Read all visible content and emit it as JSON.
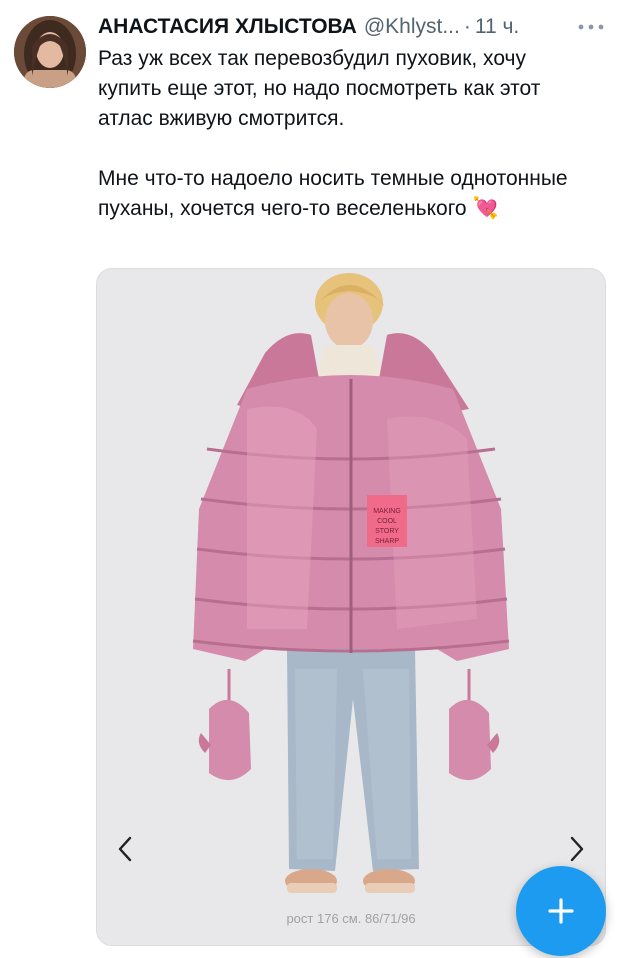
{
  "tweet": {
    "author_name": "АНАСТАСИЯ ХЛЫСТОВА",
    "author_handle": "@Khlyst...",
    "separator": "·",
    "time": "11 ч.",
    "more_icon": "more-horizontal-icon",
    "paragraph_1": "Раз уж всех так перевозбудил пуховик, хочу купить еще этот, но надо посмотреть как этот атлас вживую смотрится.",
    "paragraph_2": "Мне что-то надоело носить темные однотонные пуханы, хочется чего-то веселенького",
    "emoji": "💘"
  },
  "media": {
    "caption": "рост 176 см. 86/71/96",
    "patch_text": "MAKING COOL STORY SHARP",
    "prev_icon": "chevron-left-icon",
    "next_icon": "chevron-right-icon"
  },
  "compose": {
    "icon": "plus-icon"
  },
  "colors": {
    "accent": "#1d9bf0",
    "text": "#0f1419",
    "muted": "#536471",
    "jacket": "#d58bab"
  }
}
